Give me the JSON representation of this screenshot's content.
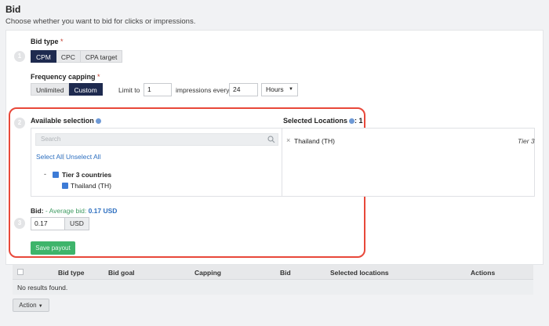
{
  "header": {
    "title": "Bid",
    "subtitle": "Choose whether you want to bid for clicks or impressions."
  },
  "steps": [
    "1",
    "2",
    "3"
  ],
  "bid_type": {
    "label": "Bid type",
    "required_mark": "*",
    "options": [
      "CPM",
      "CPC",
      "CPA target"
    ],
    "selected": "CPM"
  },
  "frequency_capping": {
    "label": "Frequency capping",
    "required_mark": "*",
    "options": [
      "Unlimited",
      "Custom"
    ],
    "selected": "Custom",
    "limit_to_label": "Limit to",
    "limit_value": "1",
    "impressions_every_label": "impressions every",
    "every_value": "24",
    "unit": "Hours"
  },
  "available": {
    "label": "Available selection",
    "search_placeholder": "Search",
    "select_all": "Select All",
    "unselect_all": "Unselect All",
    "tree": {
      "group_label": "Tier 3 countries",
      "child_label": "Thailand (TH)"
    }
  },
  "selected_locations": {
    "label": "Selected Locations",
    "count": ": 1",
    "item": "Thailand (TH)",
    "tier": "Tier 3"
  },
  "bid": {
    "label": "Bid:",
    "avg_prefix": "- Average bid:",
    "avg_value": "0.17 USD",
    "value": "0.17",
    "currency": "USD",
    "save_label": "Save payout"
  },
  "table": {
    "columns": [
      "Bid type",
      "Bid goal",
      "Capping",
      "Bid",
      "Selected locations",
      "Actions"
    ],
    "empty": "No results found."
  },
  "action_label": "Action",
  "colors": {
    "accent": "#1e2a4f",
    "save": "#3eb46b",
    "highlight": "#e8483a",
    "link": "#2d6fc0"
  }
}
